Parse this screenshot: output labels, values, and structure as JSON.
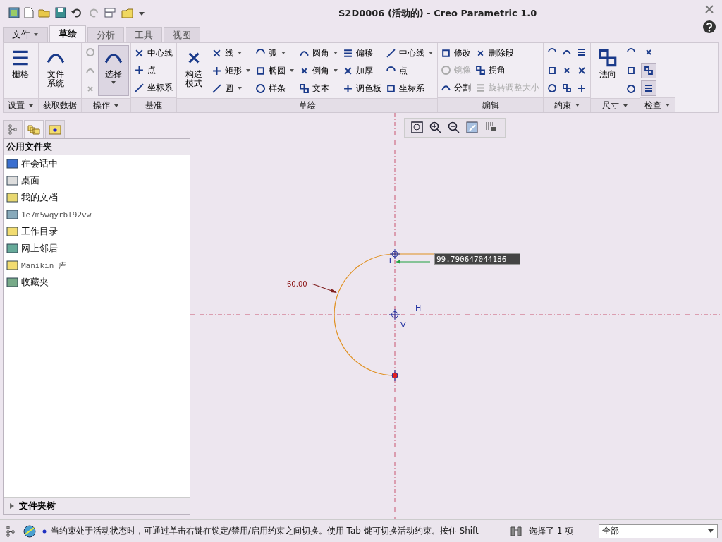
{
  "window": {
    "title": "S2D0006 (活动的) - Creo Parametric 1.0"
  },
  "menu_tabs": [
    {
      "label": "文件",
      "kind": "menu",
      "selected": false
    },
    {
      "label": "草绘",
      "kind": "tab",
      "selected": true
    },
    {
      "label": "分析",
      "kind": "tab",
      "selected": false
    },
    {
      "label": "工具",
      "kind": "tab",
      "selected": false
    },
    {
      "label": "视图",
      "kind": "tab",
      "selected": false
    }
  ],
  "ribbon": [
    {
      "label": "设置",
      "dropdown": true,
      "columns": [
        [
          {
            "kind": "large",
            "label": "栅格",
            "dropdown": false,
            "disabled": false,
            "on": false
          }
        ]
      ]
    },
    {
      "label": "获取数据",
      "dropdown": false,
      "columns": [
        [
          {
            "kind": "large",
            "label": "文件系统",
            "dropdown": false,
            "disabled": false,
            "on": false
          }
        ]
      ]
    },
    {
      "label": "操作",
      "dropdown": true,
      "columns": [
        [
          {
            "kind": "icon",
            "disabled": true,
            "on": false
          },
          {
            "kind": "icon",
            "disabled": true,
            "on": false
          },
          {
            "kind": "icon",
            "disabled": true,
            "on": false
          }
        ],
        [
          {
            "kind": "large",
            "label": "选择",
            "dropdown": true,
            "disabled": false,
            "on": true
          }
        ]
      ]
    },
    {
      "label": "基准",
      "dropdown": false,
      "columns": [
        [
          {
            "kind": "small",
            "label": "中心线",
            "dropdown": false,
            "disabled": false,
            "on": false
          },
          {
            "kind": "small",
            "label": "点",
            "dropdown": false,
            "disabled": false,
            "on": false
          },
          {
            "kind": "small",
            "label": "坐标系",
            "dropdown": false,
            "disabled": false,
            "on": false
          }
        ]
      ]
    },
    {
      "label": "草绘",
      "dropdown": false,
      "columns": [
        [
          {
            "kind": "large",
            "label": "构造模式",
            "dropdown": false,
            "disabled": false,
            "on": false
          }
        ],
        [
          {
            "kind": "small",
            "label": "线",
            "dropdown": true,
            "disabled": false,
            "on": false
          },
          {
            "kind": "small",
            "label": "矩形",
            "dropdown": true,
            "disabled": false,
            "on": false
          },
          {
            "kind": "small",
            "label": "圆",
            "dropdown": true,
            "disabled": false,
            "on": false
          }
        ],
        [
          {
            "kind": "small",
            "label": "弧",
            "dropdown": true,
            "disabled": false,
            "on": false
          },
          {
            "kind": "small",
            "label": "椭圆",
            "dropdown": true,
            "disabled": false,
            "on": false
          },
          {
            "kind": "small",
            "label": "样条",
            "dropdown": false,
            "disabled": false,
            "on": false
          }
        ],
        [
          {
            "kind": "small",
            "label": "圆角",
            "dropdown": true,
            "disabled": false,
            "on": false
          },
          {
            "kind": "small",
            "label": "倒角",
            "dropdown": true,
            "disabled": false,
            "on": false
          },
          {
            "kind": "small",
            "label": "文本",
            "dropdown": false,
            "disabled": false,
            "on": false
          }
        ],
        [
          {
            "kind": "small",
            "label": "偏移",
            "dropdown": false,
            "disabled": false,
            "on": false
          },
          {
            "kind": "small",
            "label": "加厚",
            "dropdown": false,
            "disabled": false,
            "on": false
          },
          {
            "kind": "small",
            "label": "调色板",
            "dropdown": false,
            "disabled": false,
            "on": false
          }
        ],
        [
          {
            "kind": "small",
            "label": "中心线",
            "dropdown": true,
            "disabled": false,
            "on": false
          },
          {
            "kind": "small",
            "label": "点",
            "dropdown": false,
            "disabled": false,
            "on": false
          },
          {
            "kind": "small",
            "label": "坐标系",
            "dropdown": false,
            "disabled": false,
            "on": false
          }
        ]
      ]
    },
    {
      "label": "编辑",
      "dropdown": false,
      "columns": [
        [
          {
            "kind": "small",
            "label": "修改",
            "dropdown": false,
            "disabled": false,
            "on": false
          },
          {
            "kind": "small",
            "label": "镜像",
            "dropdown": false,
            "disabled": true,
            "on": false
          },
          {
            "kind": "small",
            "label": "分割",
            "dropdown": false,
            "disabled": false,
            "on": false
          }
        ],
        [
          {
            "kind": "small",
            "label": "删除段",
            "dropdown": false,
            "disabled": false,
            "on": false
          },
          {
            "kind": "small",
            "label": "拐角",
            "dropdown": false,
            "disabled": false,
            "on": false
          },
          {
            "kind": "small",
            "label": "旋转调整大小",
            "dropdown": false,
            "disabled": true,
            "on": false
          }
        ]
      ]
    },
    {
      "label": "约束",
      "dropdown": true,
      "columns": [
        [
          {
            "kind": "icon",
            "disabled": false,
            "on": false
          },
          {
            "kind": "icon",
            "disabled": false,
            "on": false
          },
          {
            "kind": "icon",
            "disabled": false,
            "on": false
          }
        ],
        [
          {
            "kind": "icon",
            "disabled": false,
            "on": false
          },
          {
            "kind": "icon",
            "disabled": false,
            "on": false
          },
          {
            "kind": "icon",
            "disabled": false,
            "on": false
          }
        ],
        [
          {
            "kind": "icon",
            "disabled": false,
            "on": false
          },
          {
            "kind": "icon",
            "disabled": false,
            "on": false
          },
          {
            "kind": "icon",
            "disabled": false,
            "on": false
          }
        ]
      ]
    },
    {
      "label": "尺寸",
      "dropdown": true,
      "columns": [
        [
          {
            "kind": "large",
            "label": "法向",
            "dropdown": false,
            "disabled": false,
            "on": false
          }
        ],
        [
          {
            "kind": "icon",
            "disabled": false,
            "on": false
          },
          {
            "kind": "icon",
            "disabled": false,
            "on": false
          },
          {
            "kind": "icon",
            "disabled": false,
            "on": false
          }
        ]
      ]
    },
    {
      "label": "检查",
      "dropdown": true,
      "columns": [
        [
          {
            "kind": "icon",
            "disabled": false,
            "on": false
          },
          {
            "kind": "icon",
            "disabled": false,
            "on": true
          },
          {
            "kind": "icon",
            "disabled": false,
            "on": true
          }
        ]
      ]
    }
  ],
  "navigator": {
    "tabs": [
      {
        "selected": false
      },
      {
        "selected": true
      },
      {
        "selected": false
      }
    ],
    "header": "公用文件夹",
    "items": [
      {
        "label": "在会话中",
        "kind": "text"
      },
      {
        "label": "桌面",
        "kind": "text"
      },
      {
        "label": "我的文档",
        "kind": "text"
      },
      {
        "label": "1e7m5wqyrbl92vw",
        "kind": "mono"
      },
      {
        "label": "工作目录",
        "kind": "text"
      },
      {
        "label": "网上邻居",
        "kind": "text"
      },
      {
        "label": "Manikin 库",
        "kind": "mono"
      },
      {
        "label": "收藏夹",
        "kind": "text"
      }
    ],
    "folder_tree": {
      "label": "文件夹树",
      "expanded": false
    }
  },
  "sketch": {
    "radius_dimension": "60.00",
    "dimension_input": "99.790647044186",
    "labels": [
      "T",
      "H",
      "V"
    ]
  },
  "status_bar": {
    "message": "当约束处于活动状态时，可通过单击右键在锁定/禁用/启用约束之间切换。使用 Tab 键可切换活动约束。按住 Shift",
    "selection": "选择了 1 项",
    "filter": "全部"
  }
}
